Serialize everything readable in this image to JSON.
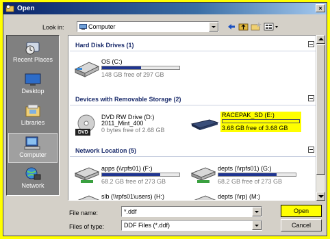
{
  "window": {
    "title": "Open",
    "close_glyph": "×"
  },
  "lookin": {
    "label": "Look in:",
    "value": "Computer"
  },
  "toolbar": {
    "icons": [
      "back-icon",
      "up-folder-icon",
      "new-folder-icon",
      "views-menu-icon"
    ]
  },
  "places": [
    {
      "label": "Recent Places",
      "icon": "recent-places-icon",
      "selected": false
    },
    {
      "label": "Desktop",
      "icon": "desktop-icon",
      "selected": false
    },
    {
      "label": "Libraries",
      "icon": "libraries-icon",
      "selected": false
    },
    {
      "label": "Computer",
      "icon": "computer-icon",
      "selected": true
    },
    {
      "label": "Network",
      "icon": "network-icon",
      "selected": false
    }
  ],
  "groups": {
    "hdd": {
      "title": "Hard Disk Drives (1)",
      "items": [
        {
          "name": "OS (C:)",
          "free": "148 GB free of 297 GB",
          "used_fraction": 0.5
        }
      ]
    },
    "removable": {
      "title": "Devices with Removable Storage (2)",
      "items": [
        {
          "name": "DVD RW Drive (D:)",
          "sub": "2011_Mint_400",
          "free": "0 bytes free of 2.68 GB",
          "badge": "DVD"
        },
        {
          "name": "RACEPAK_SD (E:)",
          "free": "3.68 GB free of 3.68 GB",
          "used_fraction": 0.0,
          "highlight": "#ffff00"
        }
      ]
    },
    "network": {
      "title": "Network Location (5)",
      "items": [
        {
          "name": "apps (\\\\rpfs01) (F:)",
          "free": "68.2 GB free of 273 GB",
          "used_fraction": 0.75
        },
        {
          "name": "depts (\\\\rpfs01) (G:)",
          "free": "68.2 GB free of 273 GB",
          "used_fraction": 0.75
        },
        {
          "name": "slb (\\\\rpfs01\\users) (H:)",
          "free": ""
        },
        {
          "name": "depts (\\\\rp) (M:)",
          "free": ""
        }
      ]
    }
  },
  "filename": {
    "label": "File name:",
    "value": "*.ddf"
  },
  "filetype": {
    "label": "Files of type:",
    "value": "DDF Files (*.ddf)"
  },
  "buttons": {
    "open": "Open",
    "cancel": "Cancel"
  },
  "colors": {
    "bar": "#1f3591",
    "highlight": "#ffff00",
    "title": "#0a246a"
  }
}
